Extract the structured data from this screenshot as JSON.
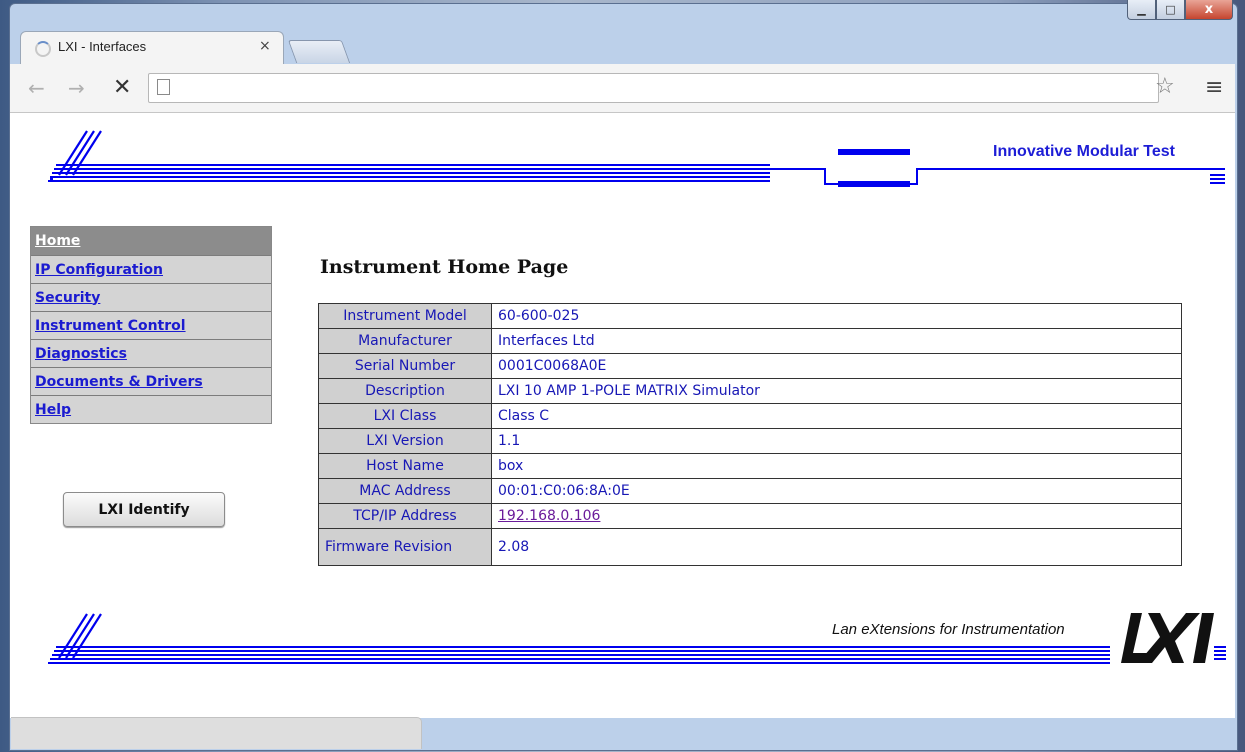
{
  "window": {
    "minimize": "▁",
    "maximize": "□",
    "close": "x"
  },
  "tab": {
    "title": "LXI - Interfaces",
    "close": "×"
  },
  "toolbar": {
    "back": "←",
    "forward": "→",
    "stop": "✕",
    "star": "☆",
    "menu": "≡"
  },
  "header": {
    "company": "Innovative Modular Test"
  },
  "sidebar": {
    "items": [
      {
        "label": "Home"
      },
      {
        "label": "IP Configuration"
      },
      {
        "label": "Security"
      },
      {
        "label": "Instrument Control"
      },
      {
        "label": "Diagnostics"
      },
      {
        "label": "Documents & Drivers"
      },
      {
        "label": "Help"
      }
    ],
    "identify_button": "LXI Identify"
  },
  "page": {
    "title": "Instrument Home Page"
  },
  "info": [
    {
      "key": "Instrument Model",
      "value": "60-600-025"
    },
    {
      "key": "Manufacturer",
      "value": "Interfaces Ltd"
    },
    {
      "key": "Serial Number",
      "value": "0001C0068A0E"
    },
    {
      "key": "Description",
      "value": "LXI 10 AMP 1-POLE MATRIX Simulator"
    },
    {
      "key": "LXI Class",
      "value": "Class C"
    },
    {
      "key": "LXI Version",
      "value": "1.1"
    },
    {
      "key": "Host Name",
      "value": "box"
    },
    {
      "key": "MAC Address",
      "value": "00:01:C0:06:8A:0E"
    },
    {
      "key": "TCP/IP Address",
      "value": "192.168.0.106"
    },
    {
      "key": "Firmware Revision",
      "value": "2.08"
    }
  ],
  "footer": {
    "tagline": "Lan eXtensions for Instrumentation",
    "logo": "LXI"
  },
  "colors": {
    "link": "#1b1bd0",
    "brand_blue": "#0000ff",
    "visited": "#6a1b9a"
  }
}
